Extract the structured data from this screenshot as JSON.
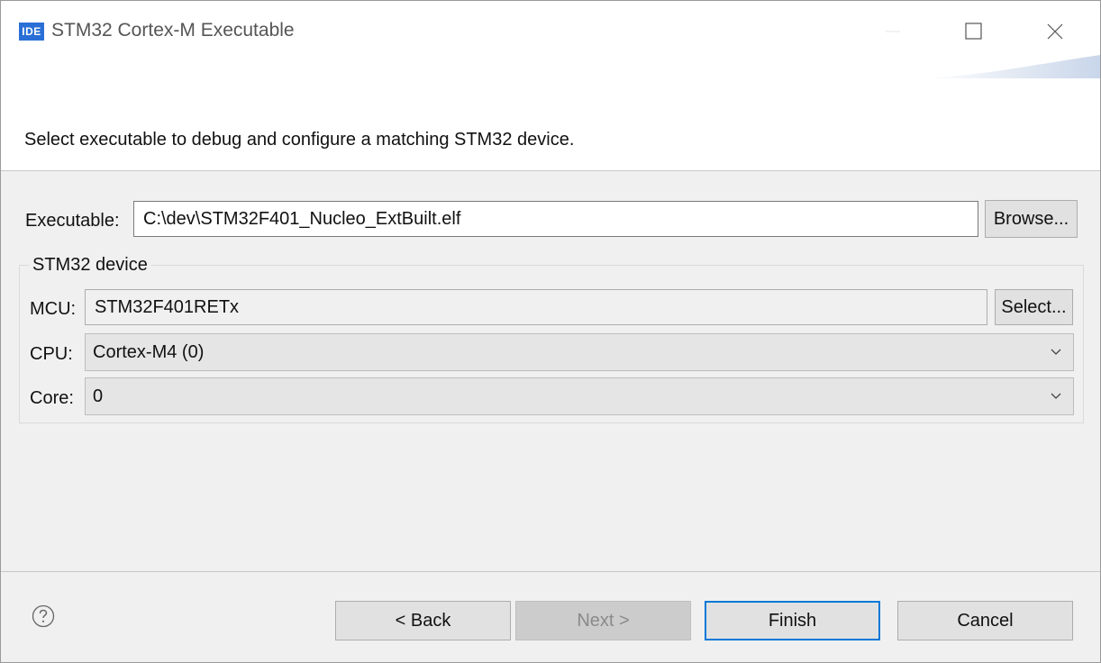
{
  "window": {
    "app_badge": "IDE",
    "title": "STM32 Cortex-M Executable"
  },
  "banner": {
    "message": "Select executable to debug and configure a matching STM32 device."
  },
  "form": {
    "executable_label": "Executable:",
    "executable_value": "C:\\dev\\STM32F401_Nucleo_ExtBuilt.elf",
    "browse_label": "Browse...",
    "device_group_title": "STM32 device",
    "mcu_label": "MCU:",
    "mcu_value": "STM32F401RETx",
    "select_label": "Select...",
    "cpu_label": "CPU:",
    "cpu_value": "Cortex-M4 (0)",
    "core_label": "Core:",
    "core_value": "0"
  },
  "footer": {
    "back_label": "< Back",
    "next_label": "Next >",
    "finish_label": "Finish",
    "cancel_label": "Cancel"
  },
  "icons": {
    "help": "help-icon",
    "minimize": "minimize-icon",
    "maximize": "maximize-icon",
    "close": "close-icon",
    "dropdown": "chevron-down-icon"
  },
  "colors": {
    "accent": "#0078d7",
    "app_icon": "#2a6fd6"
  }
}
